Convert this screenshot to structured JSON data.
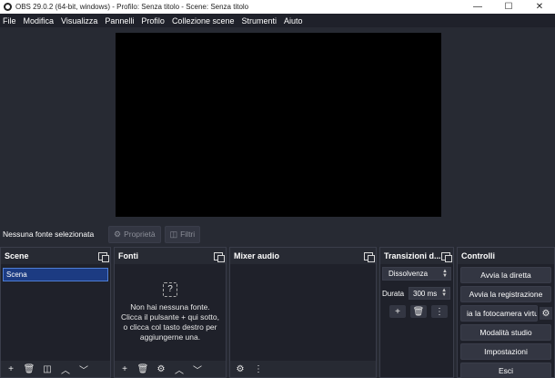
{
  "window": {
    "title": "OBS 29.0.2 (64-bit, windows) - Profilo: Senza titolo - Scene: Senza titolo",
    "minimize": "—",
    "maximize": "☐",
    "close": "✕"
  },
  "menu": [
    "File",
    "Modifica",
    "Visualizza",
    "Pannelli",
    "Profilo",
    "Collezione scene",
    "Strumenti",
    "Aiuto"
  ],
  "source_bar": {
    "no_source": "Nessuna fonte selezionata",
    "properties": "Proprietà",
    "filters": "Filtri"
  },
  "docks": {
    "scenes": {
      "title": "Scene",
      "items": [
        "Scena"
      ]
    },
    "sources": {
      "title": "Fonti",
      "empty_line1": "Non hai nessuna fonte.",
      "empty_line2": "Clicca il pulsante + qui sotto,",
      "empty_line3": "o clicca col tasto destro per",
      "empty_line4": "aggiungerne una."
    },
    "mixer": {
      "title": "Mixer audio"
    },
    "transitions": {
      "title": "Transizioni d...",
      "selected": "Dissolvenza",
      "duration_label": "Durata",
      "duration_value": "300 ms"
    },
    "controls": {
      "title": "Controlli",
      "start_stream": "Avvia la diretta",
      "start_recording": "Avvia la registrazione",
      "virtual_camera": "ia la fotocamera virtu",
      "studio_mode": "Modalità studio",
      "settings": "Impostazioni",
      "exit": "Esci"
    }
  },
  "colors": {
    "background": "#272a33",
    "dock_background": "#1f212a",
    "selection": "#1c3b82",
    "preview": "#000000"
  }
}
